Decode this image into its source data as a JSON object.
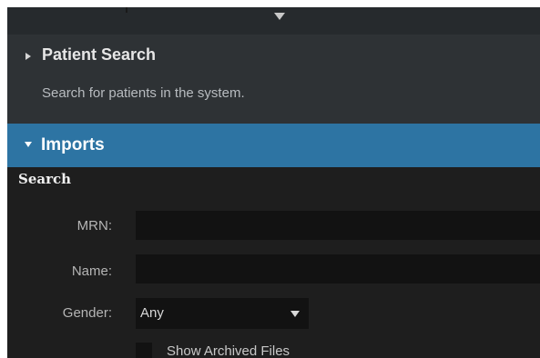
{
  "patient_search": {
    "title": "Patient Search",
    "description": "Search for patients in the system."
  },
  "imports": {
    "title": "Imports"
  },
  "search_form": {
    "heading": "Search",
    "mrn_label": "MRN:",
    "mrn_value": "",
    "name_label": "Name:",
    "name_value": "",
    "gender_label": "Gender:",
    "gender_value": "Any",
    "show_archived_label": "Show Archived Files",
    "show_archived_checked": false
  },
  "colors": {
    "accent": "#2d74a3",
    "panel_dark": "#1e1e1e",
    "section_bg": "#2e3235",
    "input_bg": "#121212"
  },
  "icons": {
    "collapse": "triangle-down-icon",
    "patient_search_caret": "caret-right-icon",
    "imports_caret": "caret-down-icon",
    "gender_dropdown": "chevron-down-icon"
  }
}
